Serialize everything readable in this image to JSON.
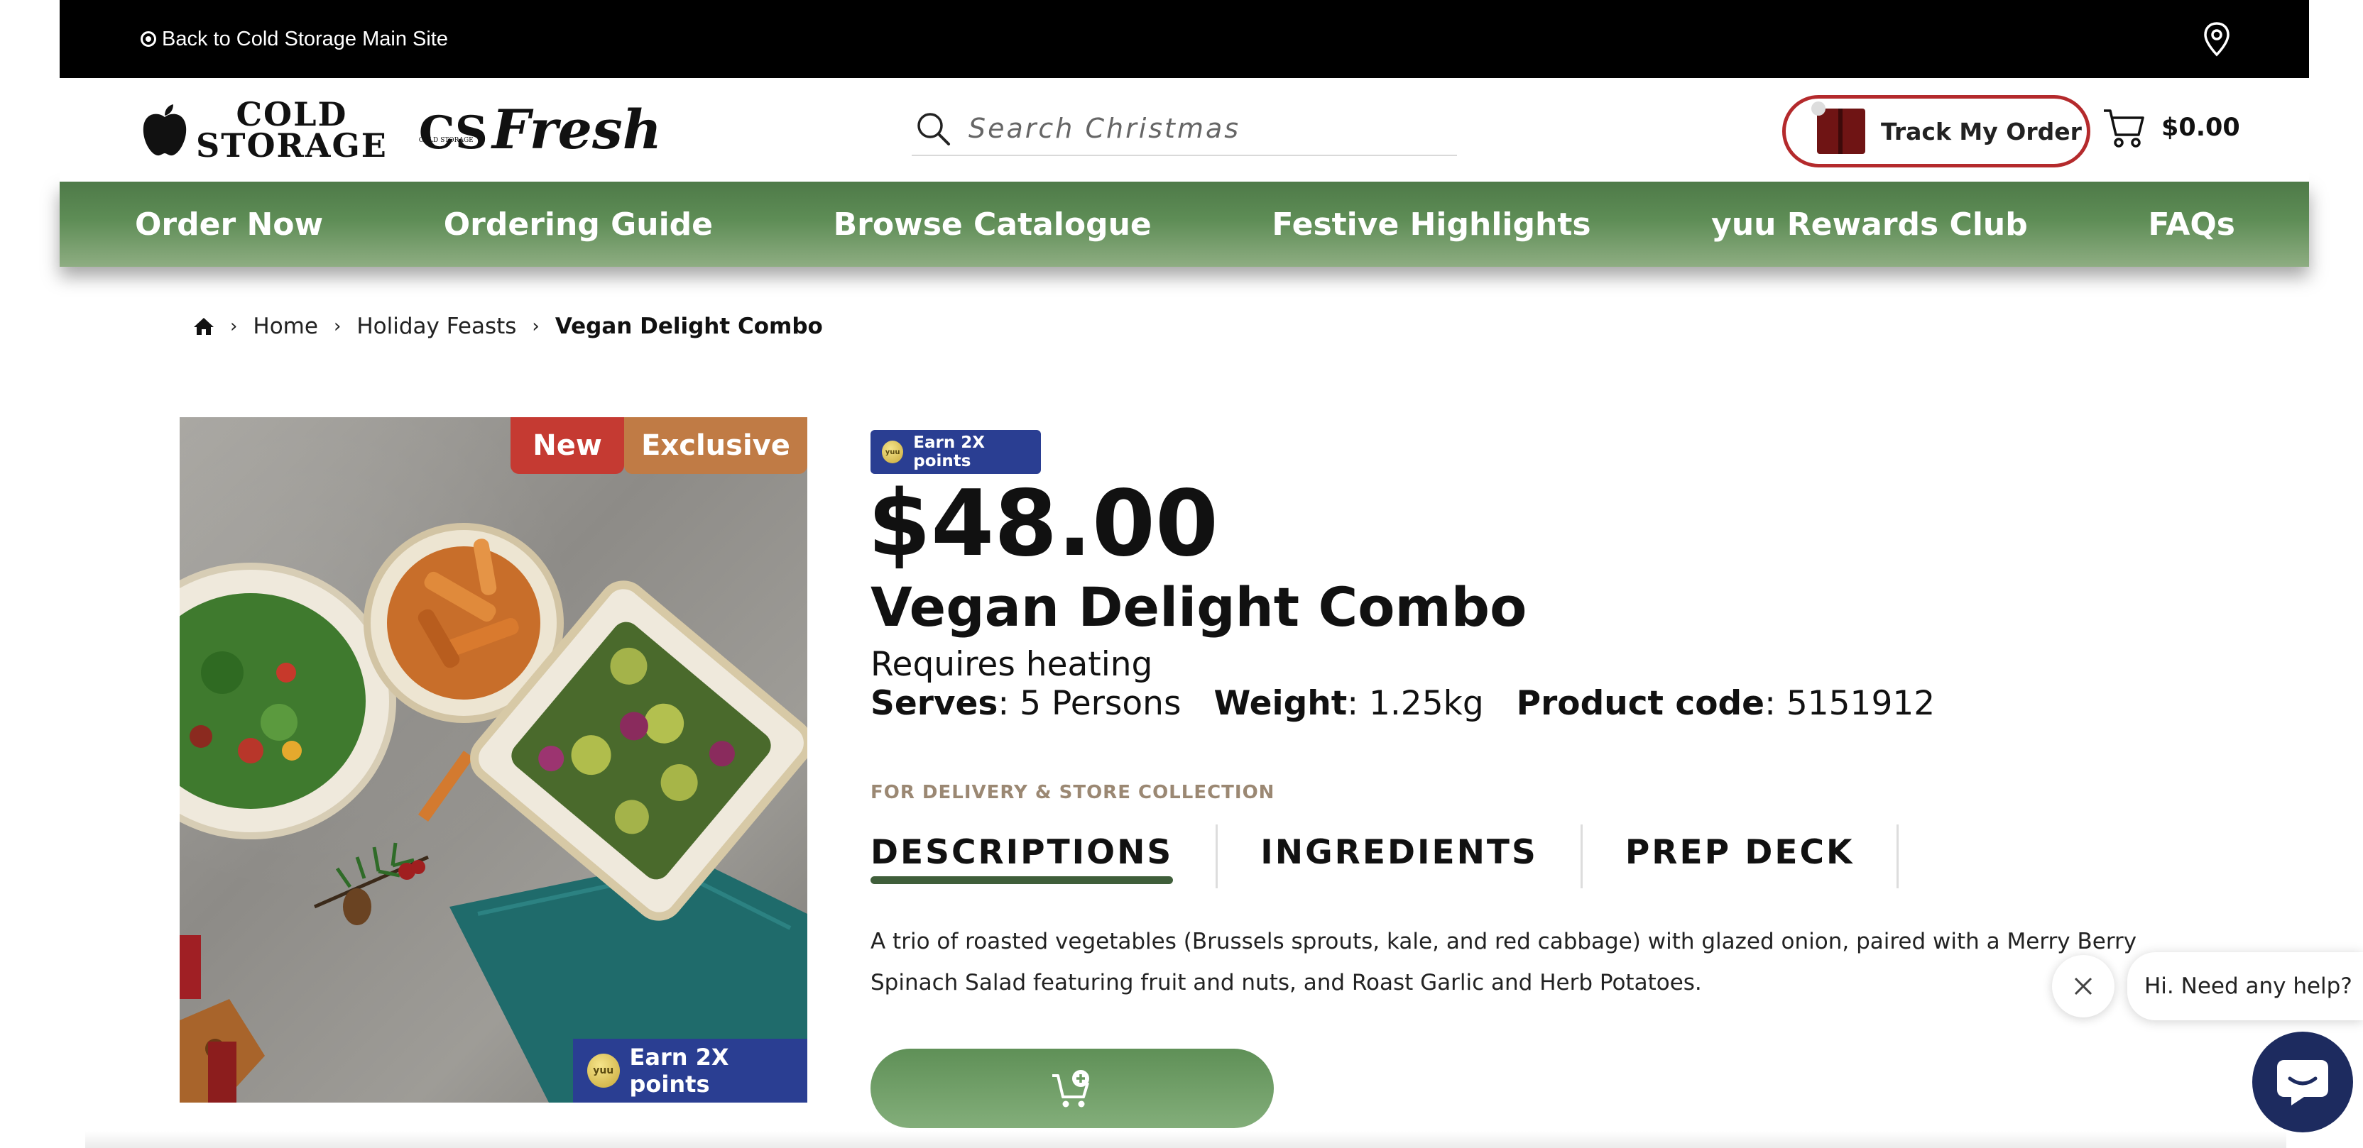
{
  "topbar": {
    "back_label": "Back to Cold Storage Main Site"
  },
  "header": {
    "logo_cold_line1": "COLD",
    "logo_cold_line2": "STORAGE",
    "logo_fresh_cs": "CS",
    "logo_fresh_tag": "COLD STORAGE",
    "logo_fresh_word": "Fresh",
    "search_placeholder": "Search Christmas",
    "track_label": "Track My Order",
    "cart_total": "$0.00"
  },
  "nav": {
    "items": [
      {
        "label": "Order Now"
      },
      {
        "label": "Ordering Guide"
      },
      {
        "label": "Browse Catalogue"
      },
      {
        "label": "Festive Highlights"
      },
      {
        "label": "yuu Rewards Club"
      },
      {
        "label": "FAQs"
      }
    ]
  },
  "breadcrumb": {
    "home": "Home",
    "category": "Holiday Feasts",
    "current": "Vegan Delight Combo"
  },
  "product": {
    "badge_new": "New",
    "badge_exclusive": "Exclusive",
    "image_points": "Earn 2X points",
    "points_pill": "Earn 2X points",
    "yuu_mark": "yuu",
    "price": "$48.00",
    "title": "Vegan Delight Combo",
    "heating": "Requires heating",
    "serves_label": "Serves",
    "serves_value": ": 5 Persons",
    "weight_label": "Weight",
    "weight_value": ": 1.25kg",
    "code_label": "Product code",
    "code_value": ": 5151912",
    "delivery": "FOR DELIVERY & STORE COLLECTION",
    "tabs": [
      {
        "label": "DESCRIPTIONS",
        "active": true
      },
      {
        "label": "INGREDIENTS",
        "active": false
      },
      {
        "label": "PREP DECK",
        "active": false
      }
    ],
    "description": "A trio of roasted vegetables (Brussels sprouts, kale, and red cabbage) with glazed onion, paired with a Merry Berry Spinach Salad featuring fruit and nuts, and Roast Garlic and Herb Potatoes."
  },
  "chat": {
    "greeting": "Hi. Need any help?"
  },
  "colors": {
    "nav_green": "#5e8d56",
    "brand_red": "#b42a2c",
    "yuu_blue": "#2a3e92",
    "badge_new": "#c53a32",
    "badge_exclusive": "#c07b45",
    "chat_navy": "#1d2b5f"
  }
}
